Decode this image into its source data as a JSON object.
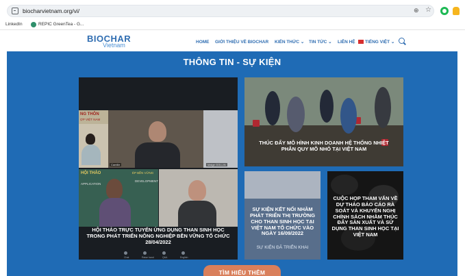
{
  "browser": {
    "url": "biocharvietnam.org/vi/",
    "bookmarks": [
      "LinkedIn",
      "REPIC GreenTea - G..."
    ],
    "icons": [
      "site-info-icon",
      "zoom-icon",
      "star-icon",
      "extension-icon",
      "profile-icon"
    ]
  },
  "header": {
    "logo_main": "BIOCHAR",
    "logo_sub": "Vietnam",
    "nav": [
      "HOME",
      "GIỚI THIỆU VỀ BIOCHAR",
      "KIẾN THỨC ⌄",
      "TIN TỨC ⌄",
      "LIÊN HỆ",
      "TIẾNG VIỆT ⌄"
    ]
  },
  "section": {
    "title": "THÔNG TIN - SỰ KIỆN",
    "cards": [
      {
        "caption": "HỘI THẢO TRỰC TUYẾN ỨNG DỤNG THAN SINH HỌC TRONG PHÁT TRIỂN NÔNG NGHIỆP BỀN VỮNG TỔ CHỨC 28/04/2022",
        "screen_text": [
          "NG THÔN",
          "ỢP VIỆT NAM",
          "HỘI THẢO",
          "ÉP BỀN VỮNG",
          "APPLICATION",
          "DEVELOPMENT"
        ],
        "participants": [
          "Camille",
          "Maige GOLLIN"
        ],
        "toolbar": [
          "Chat",
          "Raise hand",
          "Q&A",
          "English"
        ]
      },
      {
        "caption": "THÚC ĐẨY MÔ HÌNH KINH DOANH HỆ THỐNG NHIỆT PHÂN QUY MÔ NHỎ TẠI VIỆT NAM"
      },
      {
        "caption": "SỰ KIỆN KẾT NỐI NHẰM PHÁT TRIỂN THỊ TRƯỜNG CHO THAN SINH HỌC TẠI VIỆT NAM TỔ CHỨC VÀO NGÀY 16/09/2022",
        "subcaption": "SỰ KIỆN ĐÃ TRIỂN KHAI"
      },
      {
        "caption": "CUỘC HỌP THAM VẤN VỀ DỰ THẢO BÁO CÁO RÀ SOÁT VÀ KHUYẾN NGHỊ CHÍNH SÁCH NHẰM THÚC ĐẨY SẢN XUẤT VÀ SỬ DỤNG THAN SINH HỌC TẠI VIỆT NAM"
      }
    ],
    "cta": "TÌM HIỂU THÊM"
  },
  "colors": {
    "brand_blue": "#1f6bb5",
    "cta": "#d97f5b",
    "flag_red": "#d62f2f"
  }
}
